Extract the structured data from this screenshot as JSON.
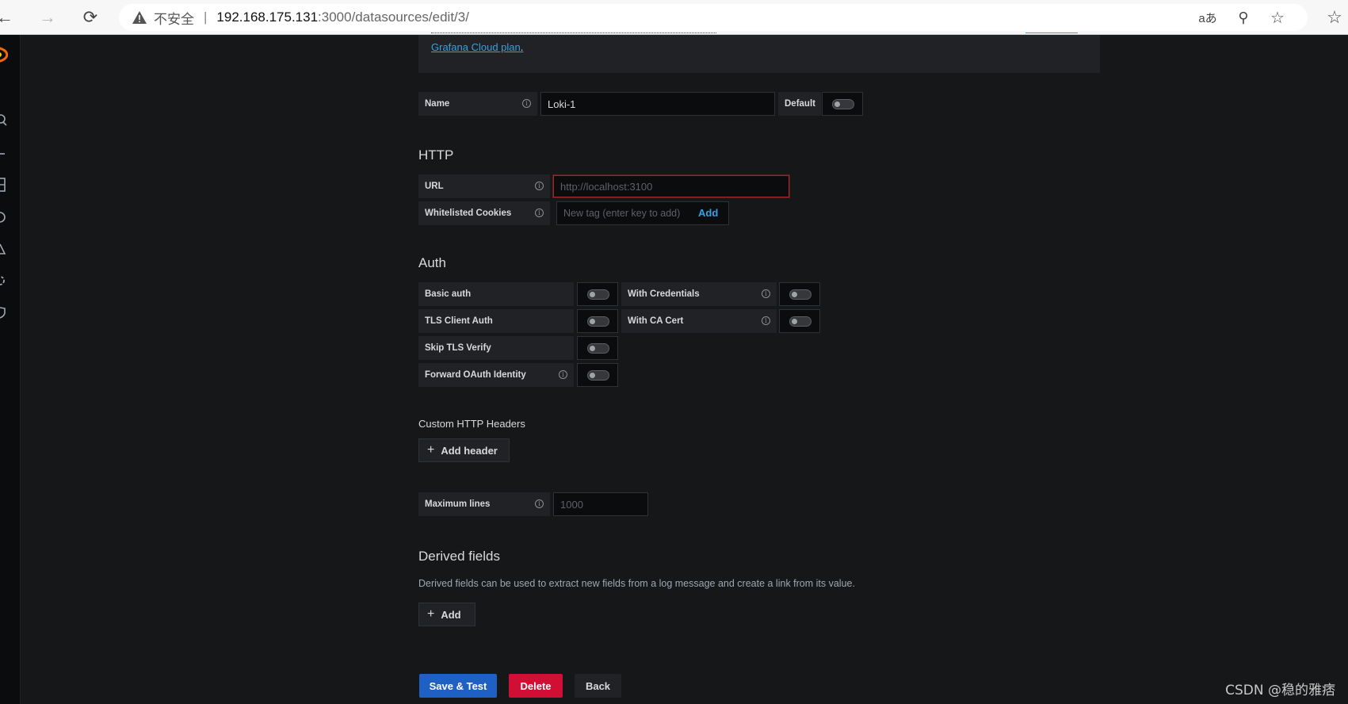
{
  "browser": {
    "back_glyph": "←",
    "forward_glyph": "→",
    "reload_glyph": "⟳",
    "insecure_label": "不安全",
    "separator": "|",
    "url_host": "192.168.175.131",
    "url_path": ":3000/datasources/edit/3/",
    "read_aloud_glyph": "aあ",
    "zoom_glyph": "⚲",
    "fav_glyph": "☆",
    "favorites_glyph": "☆"
  },
  "sidebar": {
    "icons": [
      "grafana-logo-icon",
      "search-icon",
      "plus-icon",
      "dashboards-icon",
      "explore-icon",
      "alerting-icon",
      "configuration-icon",
      "shield-icon"
    ]
  },
  "info_box": {
    "link_text": "Grafana Cloud plan",
    "trailing": "."
  },
  "name_row": {
    "label": "Name",
    "value": "Loki-1",
    "default_label": "Default"
  },
  "http": {
    "title": "HTTP",
    "url_label": "URL",
    "url_placeholder": "http://localhost:3100",
    "cookies_label": "Whitelisted Cookies",
    "cookies_placeholder": "New tag (enter key to add)",
    "cookies_add": "Add"
  },
  "auth": {
    "title": "Auth",
    "basic_auth": "Basic auth",
    "with_credentials": "With Credentials",
    "tls_client_auth": "TLS Client Auth",
    "with_ca_cert": "With CA Cert",
    "skip_tls": "Skip TLS Verify",
    "forward_oauth": "Forward OAuth Identity"
  },
  "headers": {
    "title": "Custom HTTP Headers",
    "add_header": "Add header"
  },
  "max_lines": {
    "label": "Maximum lines",
    "placeholder": "1000"
  },
  "derived": {
    "title": "Derived fields",
    "description": "Derived fields can be used to extract new fields from a log message and create a link from its value.",
    "add": "Add"
  },
  "actions": {
    "save": "Save & Test",
    "delete": "Delete",
    "back": "Back"
  },
  "watermark": "CSDN @稳的雅痞",
  "colors": {
    "background": "#161719",
    "panel": "#202226",
    "input_bg": "#0b0c0e",
    "primary": "#1f60c4",
    "danger": "#d10e34",
    "link": "#33a2e5"
  }
}
